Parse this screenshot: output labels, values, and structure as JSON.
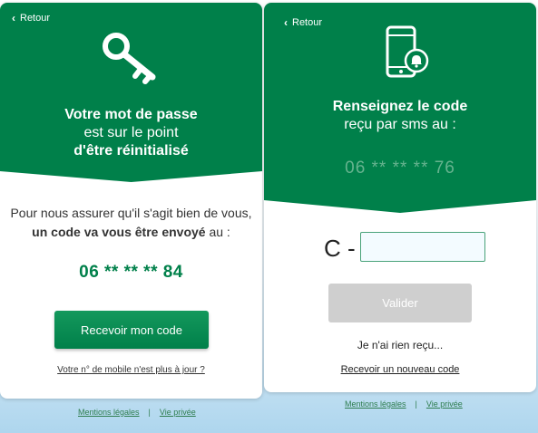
{
  "left": {
    "back_label": "Retour",
    "title_line1": "Votre mot de passe",
    "title_line2": "est sur le point",
    "title_line3": "d'être réinitialisé",
    "body_line1": "Pour nous assurer qu'il s'agit bien de vous,",
    "body_bold": "un code va vous être envoyé",
    "body_tail": " au :",
    "phone": "06 ** ** ** 84",
    "receive_button": "Recevoir mon code",
    "mobile_link": "Votre n° de mobile n'est plus à jour ?",
    "footer": {
      "legal": "Mentions légales",
      "sep": "|",
      "privacy": "Vie privée"
    }
  },
  "right": {
    "back_label": "Retour",
    "title_line1": "Renseignez le code",
    "title_line2": "reçu par sms au :",
    "phone": "06 ** ** ** 76",
    "code_prefix": "C -",
    "code_value": "",
    "validate_button": "Valider",
    "no_code_text": "Je n'ai rien reçu...",
    "resend_link": "Recevoir un nouveau code",
    "footer": {
      "legal": "Mentions légales",
      "sep": "|",
      "privacy": "Vie privée"
    }
  },
  "colors": {
    "brand_green": "#00804a",
    "disabled_gray": "#cfcfcf",
    "masked_phone": "#66b38f"
  },
  "icons": {
    "left": "key-icon",
    "right": "phone-notification-icon",
    "back": "chevron-left-icon"
  }
}
